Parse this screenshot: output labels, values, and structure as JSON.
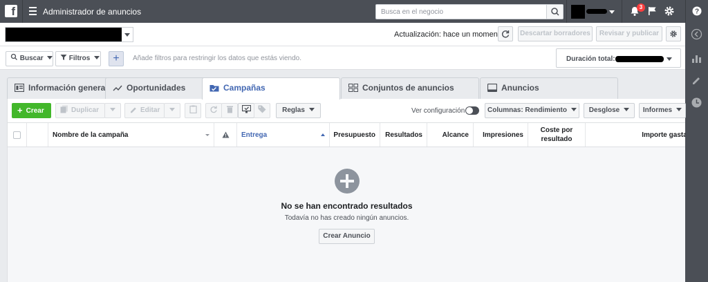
{
  "topbar": {
    "logo_letter": "f",
    "title": "Administrador de anuncios",
    "search_placeholder": "Busca en el negocio",
    "notification_count": "3"
  },
  "header": {
    "update_status": "Actualización: hace un momento",
    "discard_label": "Descartar borradores",
    "review_label": "Revisar y publicar"
  },
  "filters": {
    "search_label": "Buscar",
    "filters_label": "Filtros",
    "add_filter": "+",
    "hint": "Añade filtros para restringir los datos que estás viendo.",
    "duration_label": "Duración total:"
  },
  "tabs": [
    {
      "label": "Información general ...",
      "icon": "overview-icon"
    },
    {
      "label": "Oportunidades",
      "icon": "trend-icon"
    },
    {
      "label": "Campañas",
      "icon": "folder-icon",
      "active": true
    },
    {
      "label": "Conjuntos de anuncios",
      "icon": "grid-icon"
    },
    {
      "label": "Anuncios",
      "icon": "ad-icon"
    }
  ],
  "toolbar": {
    "create_label": "Crear",
    "duplicate_label": "Duplicar",
    "edit_label": "Editar",
    "rules_label": "Reglas",
    "view_config_label": "Ver configuración",
    "columns_label": "Columnas: Rendimiento",
    "breakdown_label": "Desglose",
    "reports_label": "Informes"
  },
  "table": {
    "columns": {
      "name": "Nombre de la campaña",
      "delivery": "Entrega",
      "budget": "Presupuesto",
      "results": "Resultados",
      "reach": "Alcance",
      "impressions": "Impresiones",
      "cost_per_result": "Coste por resultado",
      "amount_spent": "Importe gastado"
    },
    "empty_title": "No se han encontrado resultados",
    "empty_subtitle": "Todavía no has creado ningún anuncios.",
    "empty_button": "Crear Anuncio"
  },
  "colors": {
    "topbar": "#4b4f56",
    "accent": "#4267b2",
    "create_green": "#42b72a",
    "notification_red": "#fa3e3e"
  }
}
